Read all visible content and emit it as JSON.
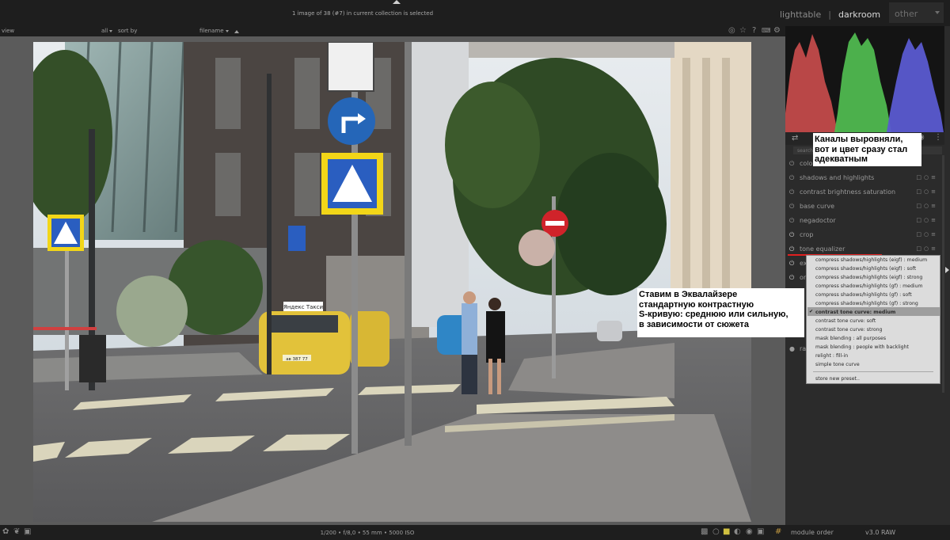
{
  "header": {
    "collection_info": "1 image of 38 (#7) in current collection is selected",
    "tabs": [
      "lighttable",
      "darkroom",
      "other"
    ],
    "active_tab": "darkroom",
    "separator": "|"
  },
  "filterbar": {
    "view_label": "view",
    "filter_value": "all",
    "sort_label": "sort by",
    "sort_value": "filename"
  },
  "top_icons": [
    "globe-icon",
    "star-icon",
    "help-icon",
    "keyboard-icon",
    "gear-icon"
  ],
  "bottom_bar": {
    "exif": "1/200 • f/8,0 • 55 mm • 5000 ISO",
    "module_order_label": "module order",
    "module_order_value": "v3.0 RAW"
  },
  "right_panel": {
    "search_placeholder": "search modules by name",
    "modules": [
      {
        "label": "color calibration",
        "visible": "colo"
      },
      {
        "label": "shadows and highlights"
      },
      {
        "label": "contrast brightness saturation"
      },
      {
        "label": "base curve"
      },
      {
        "label": "negadoctor"
      },
      {
        "label": "crop"
      },
      {
        "label": "tone equalizer"
      },
      {
        "label": "ex"
      },
      {
        "label": "or"
      },
      {
        "label": "ra"
      }
    ],
    "module_visible_labels": {
      "m0": "colo",
      "m1": "shadows and highlights",
      "m2": "contrast brightness saturation",
      "m3": "base curve",
      "m4": "negadoctor",
      "m5": "crop",
      "m6": "tone equalizer",
      "m7": "ex",
      "m8": "or",
      "m9": "ra"
    }
  },
  "preset_menu": {
    "items": [
      "compress shadows/highlights (eigf) : medium",
      "compress shadows/highlights (eigf) : soft",
      "compress shadows/highlights (eigf) : strong",
      "compress shadows/highlights (gf) : medium",
      "compress shadows/highlights (gf) : soft",
      "compress shadows/highlights (gf) : strong",
      "contrast tone curve: medium",
      "contrast tone curve: soft",
      "contrast tone curve: strong",
      "mask blending : all purposes",
      "mask blending : people with backlight",
      "relight : fill-in",
      "simple tone curve"
    ],
    "selected": "contrast tone curve: medium",
    "store_new": "store new preset.."
  },
  "annotations": {
    "note1": "Каналы выровняли,\nвот и цвет сразу стал\nадекватным",
    "note2": "Ставим в Эквалайзере\nстандартную контрастную\nS-кривую: среднюю или сильную,\nв зависимости от сюжета"
  },
  "photo": {
    "taxi_sign": "Яндекс Такси",
    "plate": "ав 387 77"
  },
  "colors": {
    "histogram_red": "#c24a4a",
    "histogram_green": "#4fb84f",
    "histogram_blue": "#5a5ad0",
    "active_underline": "#e02020"
  }
}
